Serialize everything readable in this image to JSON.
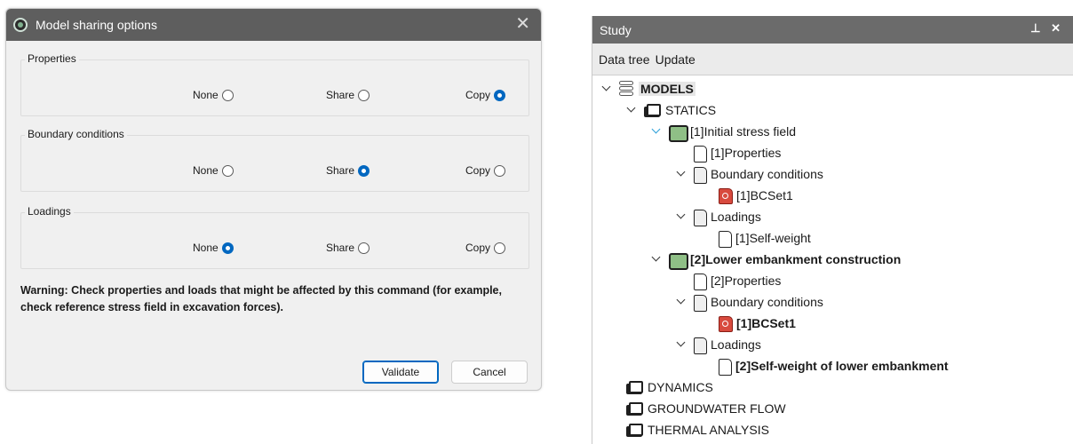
{
  "dialog": {
    "title": "Model sharing options",
    "close": "✕",
    "groups": [
      {
        "legend": "Properties",
        "options": [
          {
            "label": "None",
            "checked": false
          },
          {
            "label": "Share",
            "checked": false
          },
          {
            "label": "Copy",
            "checked": true
          }
        ]
      },
      {
        "legend": "Boundary conditions",
        "options": [
          {
            "label": "None",
            "checked": false
          },
          {
            "label": "Share",
            "checked": true
          },
          {
            "label": "Copy",
            "checked": false
          }
        ]
      },
      {
        "legend": "Loadings",
        "options": [
          {
            "label": "None",
            "checked": true
          },
          {
            "label": "Share",
            "checked": false
          },
          {
            "label": "Copy",
            "checked": false
          }
        ]
      }
    ],
    "warning": "Warning: Check properties and loads that might be affected by this command (for example, check reference stress field in excavation forces).",
    "validate_label": "Validate",
    "cancel_label": "Cancel",
    "accent_color": "#0067c0"
  },
  "panel": {
    "title": "Study",
    "pin_close": "⊥ ✕",
    "menu": [
      "Data tree",
      "Update"
    ],
    "tree": [
      {
        "label": "MODELS",
        "icon": "database-icon",
        "chevron": true
      },
      {
        "label": "STATICS",
        "icon": "folder-icon",
        "chevron": true
      },
      {
        "label": "[1]Initial stress field",
        "icon": "model-folder-icon",
        "chevron": true
      },
      {
        "label": "[1]Properties",
        "icon": "document-icon",
        "chevron": false
      },
      {
        "label": "Boundary conditions",
        "icon": "document-icon",
        "chevron": true
      },
      {
        "label": "[1]BCSet1",
        "icon": "bc-set-icon",
        "chevron": false
      },
      {
        "label": "Loadings",
        "icon": "document-icon",
        "chevron": true
      },
      {
        "label": "[1]Self-weight",
        "icon": "document-icon",
        "chevron": false
      },
      {
        "label": "[2]Lower embankment construction",
        "icon": "model-folder-icon",
        "chevron": true
      },
      {
        "label": "[2]Properties",
        "icon": "document-icon",
        "chevron": false
      },
      {
        "label": "Boundary conditions",
        "icon": "document-icon",
        "chevron": true
      },
      {
        "label": "[1]BCSet1",
        "icon": "bc-set-icon",
        "chevron": false
      },
      {
        "label": "Loadings",
        "icon": "document-icon",
        "chevron": true
      },
      {
        "label": "[2]Self-weight of lower embankment",
        "icon": "document-icon",
        "chevron": false
      },
      {
        "label": "DYNAMICS",
        "icon": "folder-icon",
        "chevron": false
      },
      {
        "label": "GROUNDWATER FLOW",
        "icon": "folder-icon",
        "chevron": false
      },
      {
        "label": "THERMAL ANALYSIS",
        "icon": "folder-icon",
        "chevron": false
      }
    ]
  }
}
